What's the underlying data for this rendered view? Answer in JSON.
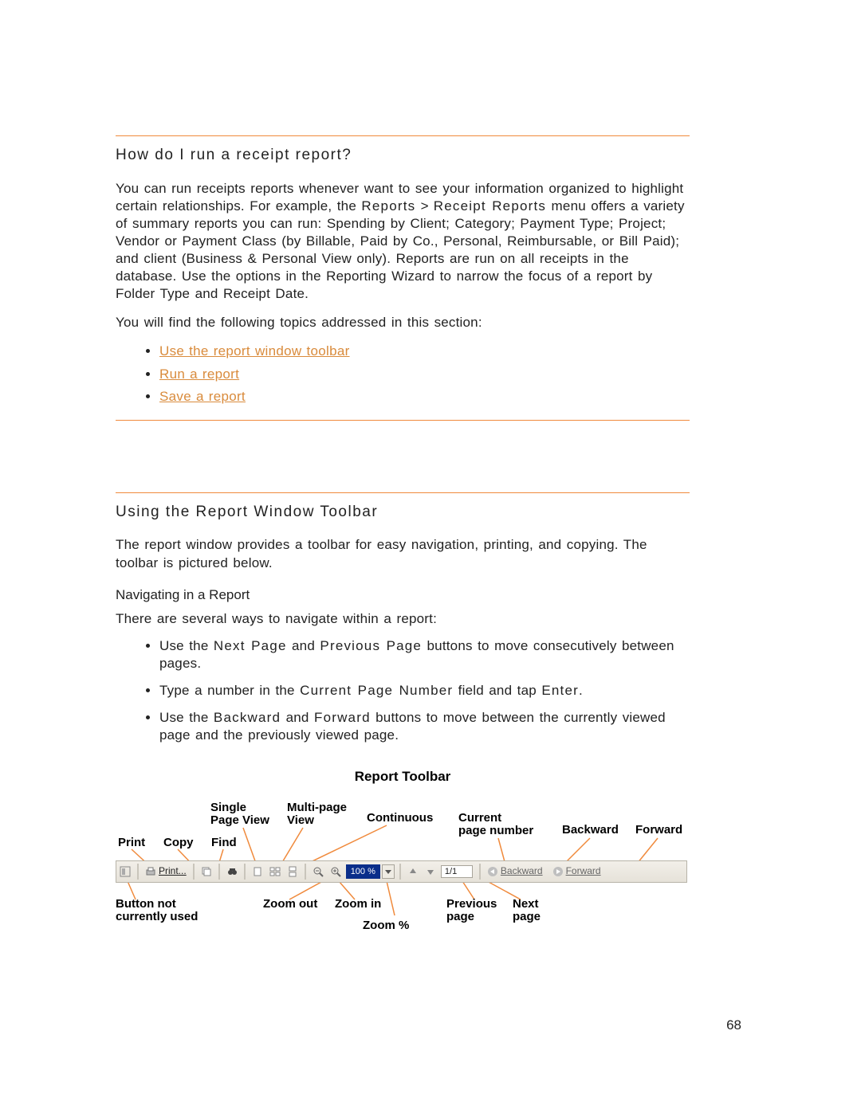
{
  "section1": {
    "heading": "How do I run a receipt report?",
    "para_pre": "You can run receipts reports whenever want to see your information organized to highlight certain relationships. For example, the ",
    "breadcrumb_a": "Reports",
    "breadcrumb_sep": " > ",
    "breadcrumb_b": "Receipt Reports",
    "para_post": " menu offers a variety of summary reports you can run: Spending by Client; Category; Payment Type; Project; Vendor or Payment Class (by Billable, Paid by Co., Personal, Reimbursable, or Bill Paid); and client (Business & Personal View only). Reports are run on all receipts in the database. Use the options in the Reporting Wizard to narrow the focus of a report by Folder Type and Receipt Date.",
    "topics_intro": "You will find the following topics addressed in this section:",
    "links": {
      "use_toolbar": "Use the report window toolbar",
      "run_report": "Run a report",
      "save_report": "Save a report"
    }
  },
  "section2": {
    "heading": "Using the Report Window Toolbar",
    "para": "The report window provides a toolbar for easy navigation, printing, and copying. The toolbar is pictured below.",
    "sub_heading": "Navigating in a Report",
    "nav_intro": "There are several ways to navigate within a report:",
    "nav_items": {
      "i1_pre": "Use the ",
      "i1_a": "Next Page",
      "i1_mid": " and ",
      "i1_b": "Previous Page",
      "i1_post": " buttons to move consecutively between pages.",
      "i2_pre": "Type a number in the ",
      "i2_a": "Current Page Number",
      "i2_mid": " field and tap ",
      "i2_b": "Enter",
      "i2_post": ".",
      "i3_pre": "Use the ",
      "i3_a": "Backward",
      "i3_mid": " and ",
      "i3_b": "Forward",
      "i3_post": " buttons to move between the currently viewed page and the previously viewed page."
    }
  },
  "figure": {
    "title": "Report Toolbar",
    "labels": {
      "print": "Print",
      "copy": "Copy",
      "find": "Find",
      "single_page_a": "Single",
      "single_page_b": "Page View",
      "multi_page_a": "Multi-page",
      "multi_page_b": "View",
      "continuous": "Continuous",
      "current_pn_a": "Current",
      "current_pn_b": "page number",
      "backward": "Backward",
      "forward": "Forward",
      "unused_a": "Button not",
      "unused_b": "currently used",
      "zoom_out": "Zoom out",
      "zoom_in": "Zoom in",
      "zoom_pct": "Zoom %",
      "prev_a": "Previous",
      "prev_b": "page",
      "next_a": "Next",
      "next_b": "page"
    },
    "toolbar": {
      "print_label": "Print...",
      "zoom_value": "100 %",
      "page_value": "1/1",
      "backward_label": "Backward",
      "forward_label": "Forward"
    }
  },
  "page_number": "68"
}
